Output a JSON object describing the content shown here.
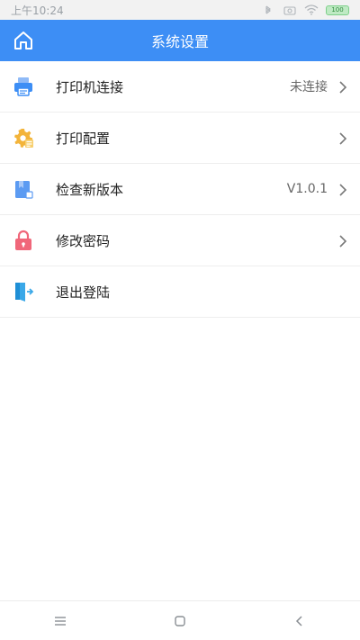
{
  "status_bar": {
    "time": "上午10:24",
    "battery": "100"
  },
  "header": {
    "title": "系统设置"
  },
  "menu": [
    {
      "label": "打印机连接",
      "value": "未连接",
      "icon": "printer-icon"
    },
    {
      "label": "打印配置",
      "value": "",
      "icon": "settings-gear-icon"
    },
    {
      "label": "检查新版本",
      "value": "V1.0.1",
      "icon": "version-icon"
    },
    {
      "label": "修改密码",
      "value": "",
      "icon": "lock-icon"
    },
    {
      "label": "退出登陆",
      "value": "",
      "icon": "logout-door-icon"
    }
  ],
  "colors": {
    "header_bg": "#3d8ef5",
    "printer_icon": "#3d8ef5",
    "config_icon": "#f3b43a",
    "version_icon": "#5c9bf2",
    "lock_icon": "#f0677a",
    "logout_icon": "#3aa8e8"
  }
}
